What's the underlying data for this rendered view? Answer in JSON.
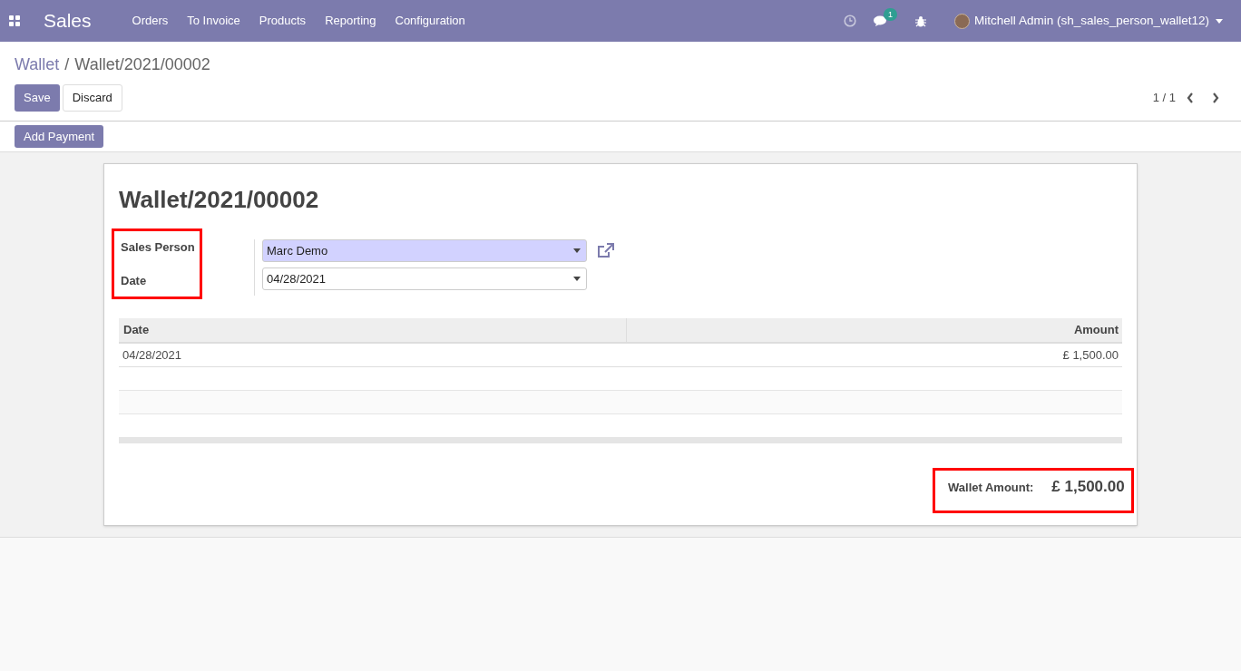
{
  "navbar": {
    "app_name": "Sales",
    "menu": [
      "Orders",
      "To Invoice",
      "Products",
      "Reporting",
      "Configuration"
    ],
    "messages_count": "1",
    "user": "Mitchell Admin (sh_sales_person_wallet12)"
  },
  "breadcrumb": {
    "parent": "Wallet",
    "separator": "/",
    "current": "Wallet/2021/00002"
  },
  "buttons": [
    "Save",
    "Discard"
  ],
  "pager": "1 / 1",
  "status_buttons": [
    "Add Payment"
  ],
  "form": {
    "title": "Wallet/2021/00002",
    "labels_highlighted": true,
    "fields": [
      {
        "label": "Sales Person",
        "value": "Marc Demo",
        "required": true,
        "external_link": true
      },
      {
        "label": "Date",
        "value": "04/28/2021",
        "required": false,
        "external_link": false
      }
    ],
    "table": {
      "columns": [
        "Date",
        "Amount"
      ],
      "rows": [
        [
          "04/28/2021",
          "£ 1,500.00"
        ]
      ]
    },
    "total": {
      "label": "Wallet Amount:",
      "value": "£ 1,500.00",
      "highlighted": true
    }
  }
}
